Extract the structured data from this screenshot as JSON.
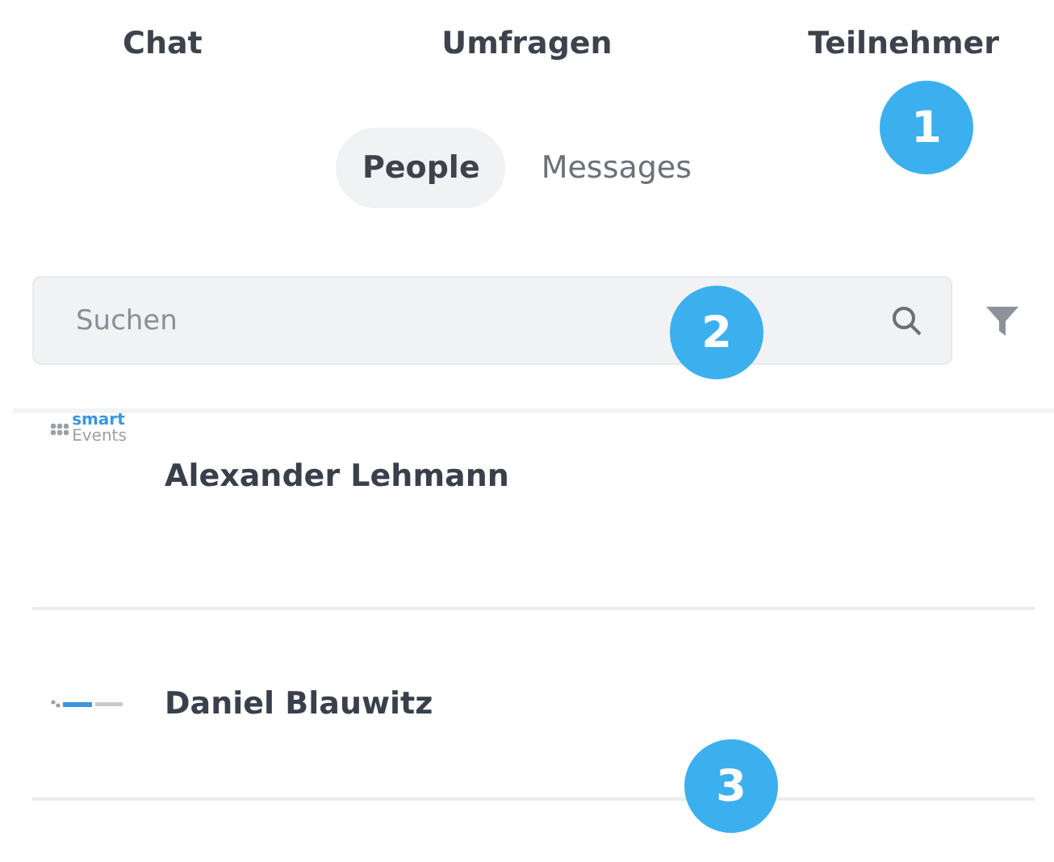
{
  "tabs": [
    {
      "label": "Chat"
    },
    {
      "label": "Umfragen"
    },
    {
      "label": "Teilnehmer"
    }
  ],
  "segments": [
    {
      "label": "People",
      "selected": true
    },
    {
      "label": "Messages",
      "selected": false
    }
  ],
  "search": {
    "placeholder": "Suchen"
  },
  "people": [
    {
      "name": "Alexander Lehmann",
      "logo": {
        "kind": "stacked",
        "line1": "smart",
        "line2": "Events"
      }
    },
    {
      "name": "Daniel Blauwitz",
      "logo": {
        "kind": "inline"
      }
    }
  ],
  "callouts": [
    {
      "number": "1"
    },
    {
      "number": "2"
    },
    {
      "number": "3"
    }
  ]
}
